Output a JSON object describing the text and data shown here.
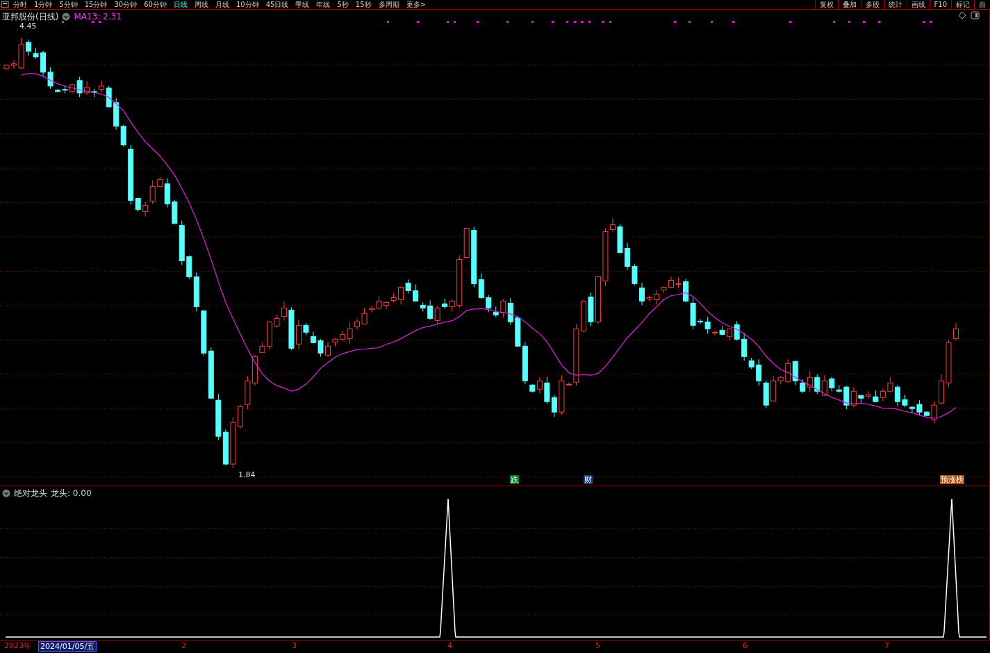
{
  "toolbar": {
    "periods": [
      {
        "label": "分时",
        "selected": false
      },
      {
        "label": "1分钟",
        "selected": false
      },
      {
        "label": "5分钟",
        "selected": false
      },
      {
        "label": "15分钟",
        "selected": false
      },
      {
        "label": "30分钟",
        "selected": false
      },
      {
        "label": "60分钟",
        "selected": false
      },
      {
        "label": "日线",
        "selected": true
      },
      {
        "label": "周线",
        "selected": false
      },
      {
        "label": "月线",
        "selected": false
      },
      {
        "label": "10分钟",
        "selected": false
      },
      {
        "label": "45日线",
        "selected": false
      },
      {
        "label": "季线",
        "selected": false
      },
      {
        "label": "年线",
        "selected": false
      },
      {
        "label": "5秒",
        "selected": false
      },
      {
        "label": "15秒",
        "selected": false
      },
      {
        "label": "多周期",
        "selected": false
      },
      {
        "label": "更多>",
        "selected": false
      }
    ],
    "tools": [
      "复权",
      "叠加",
      "多股",
      "统计",
      "画线",
      "F10",
      "标记",
      "自"
    ]
  },
  "main_chart": {
    "title": "亚邦股份(日线)",
    "indicator": "MA13: 2.31",
    "high_label": "4.45",
    "low_label": "1.84",
    "events": [
      {
        "label": "跌",
        "color": "#007a1e"
      },
      {
        "label": "财",
        "color": "#1c3f7a"
      },
      {
        "label": "预涨榜",
        "color": "#b0500a"
      }
    ]
  },
  "sub_chart": {
    "title": "绝对龙头",
    "reading": "龙头: 0.00"
  },
  "time_axis": [
    {
      "label": "2023年",
      "selected": false
    },
    {
      "label": "2024/01/05/五",
      "selected": true
    },
    {
      "label": "2",
      "selected": false
    },
    {
      "label": "3",
      "selected": false
    },
    {
      "label": "4",
      "selected": false
    },
    {
      "label": "5",
      "selected": false
    },
    {
      "label": "6",
      "selected": false
    },
    {
      "label": "7",
      "selected": false
    }
  ]
}
